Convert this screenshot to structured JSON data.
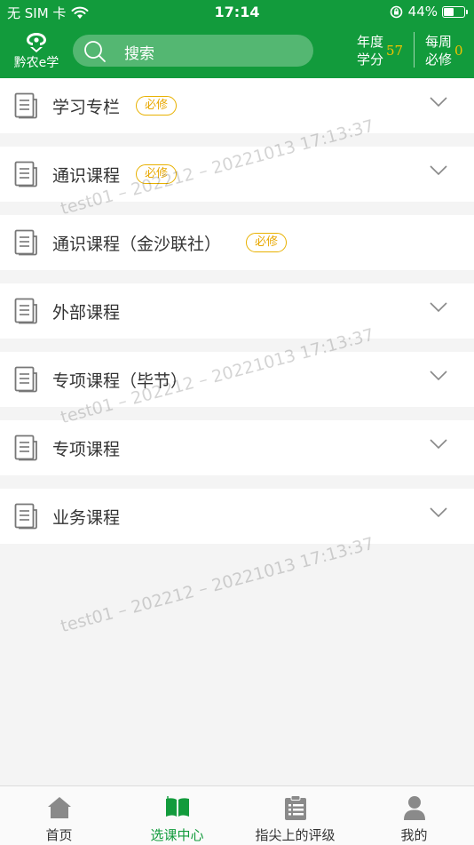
{
  "status_bar": {
    "carrier": "无 SIM 卡",
    "time": "17:14",
    "battery": "44%",
    "battery_level": 0.44
  },
  "header": {
    "logo_text": "黔农e学",
    "search_placeholder": "搜索",
    "annual": {
      "label": "年度学分",
      "value": "57"
    },
    "weekly": {
      "label": "每周必修",
      "value": "0"
    }
  },
  "courses": [
    {
      "title": "学习专栏",
      "badge": "必修",
      "expandable": true
    },
    {
      "title": "通识课程",
      "badge": "必修",
      "expandable": true
    },
    {
      "title": "通识课程（金沙联社）",
      "badge": "必修",
      "expandable": false
    },
    {
      "title": "外部课程",
      "badge": "",
      "expandable": true
    },
    {
      "title": "专项课程（毕节）",
      "badge": "",
      "expandable": true
    },
    {
      "title": "专项课程",
      "badge": "",
      "expandable": true
    },
    {
      "title": "业务课程",
      "badge": "",
      "expandable": true
    }
  ],
  "watermark": "test01 – 202212 – 20221013 17:13:37",
  "tabs": [
    {
      "label": "首页",
      "icon": "home-icon",
      "active": false
    },
    {
      "label": "选课中心",
      "icon": "book-icon",
      "active": true
    },
    {
      "label": "指尖上的评级",
      "icon": "clipboard-list-icon",
      "active": false
    },
    {
      "label": "我的",
      "icon": "person-icon",
      "active": false
    }
  ],
  "colors": {
    "brand_green": "#129b3c",
    "badge_yellow": "#e8b100",
    "stat_yellow": "#f2c200"
  }
}
